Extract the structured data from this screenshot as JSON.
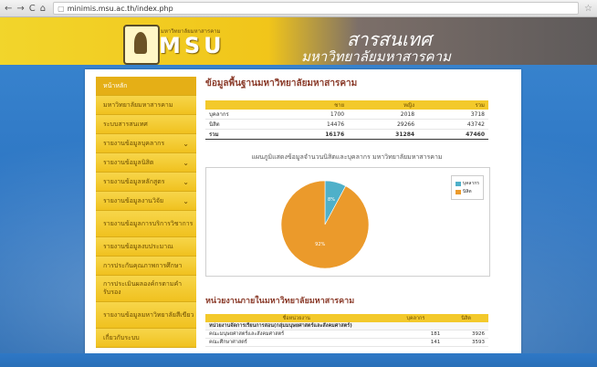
{
  "browser": {
    "url": "minimis.msu.ac.th/index.php",
    "back": "←",
    "forward": "→",
    "reload": "C",
    "home": "⌂"
  },
  "banner": {
    "brand_small": "มหาวิทยาลัยมหาสารคาม",
    "brand": "MSU",
    "title": "สารสนเทศ",
    "subtitle": "มหาวิทยาลัยมหาสารคาม"
  },
  "sidebar": {
    "items": [
      {
        "label": "หน้าหลัก",
        "chevron": false
      },
      {
        "label": "มหาวิทยาลัยมหาสารคาม",
        "chevron": false
      },
      {
        "label": "ระบบสารสนเทศ",
        "chevron": false
      },
      {
        "label": "รายงานข้อมูลบุคลากร",
        "chevron": true
      },
      {
        "label": "รายงานข้อมูลนิสิต",
        "chevron": true
      },
      {
        "label": "รายงานข้อมูลหลักสูตร",
        "chevron": true
      },
      {
        "label": "รายงานข้อมูลงานวิจัย",
        "chevron": true
      },
      {
        "label": "รายงานข้อมูลการบริการวิชาการ",
        "chevron": false
      },
      {
        "label": "รายงานข้อมูลงบประมาณ",
        "chevron": false
      },
      {
        "label": "การประกันคุณภาพการศึกษา",
        "chevron": false
      },
      {
        "label": "การประเมินผลองค์กรตามคำรับรอง",
        "chevron": false
      },
      {
        "label": "รายงานข้อมูลมหาวิทยาลัยสีเขียว",
        "chevron": false
      },
      {
        "label": "เกี่ยวกับระบบ",
        "chevron": false
      }
    ]
  },
  "main": {
    "heading": "ข้อมูลพื้นฐานมหาวิทยาลัยมหาสารคาม",
    "stats_table": {
      "headers": [
        "",
        "ชาย",
        "หญิง",
        "รวม"
      ],
      "rows": [
        [
          "บุคลากร",
          "1700",
          "2018",
          "3718"
        ],
        [
          "นิสิต",
          "14476",
          "29266",
          "43742"
        ]
      ],
      "total": [
        "รวม",
        "16176",
        "31284",
        "47460"
      ]
    },
    "chart_title": "แผนภูมิแสดงข้อมูลจำนวนนิสิตและบุคลากร มหาวิทยาลัยมหาสารคาม",
    "units_heading": "หน่วยงานภายในมหาวิทยาลัยมหาสารคาม",
    "units_table": {
      "headers": [
        "ชื่อหน่วยงาน",
        "บุคลากร",
        "นิสิต"
      ],
      "group": "หน่วยงานจัดการเรียนการสอน(กลุ่มมนุษยศาสตร์และสังคมศาสตร์)",
      "rows": [
        [
          "คณะมนุษยศาสตร์และสังคมศาสตร์",
          "181",
          "3926"
        ],
        [
          "คณะศึกษาศาสตร์",
          "141",
          "3593"
        ]
      ]
    }
  },
  "chart_data": {
    "type": "pie",
    "title": "แผนภูมิแสดงข้อมูลจำนวนนิสิตและบุคลากร มหาวิทยาลัยมหาสารคาม",
    "categories": [
      "บุคลากร",
      "นิสิต"
    ],
    "values": [
      3718,
      43742
    ],
    "slice_labels": [
      "8%",
      "92%"
    ],
    "colors": [
      "#4fb0c9",
      "#eb9a2b"
    ],
    "legend": "top-right"
  }
}
